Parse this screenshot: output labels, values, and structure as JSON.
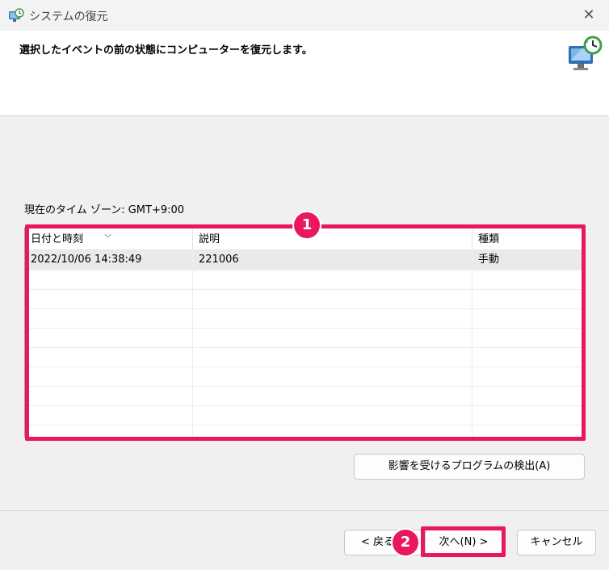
{
  "window": {
    "title": "システムの復元",
    "close_glyph": "✕"
  },
  "header": {
    "title": "選択したイベントの前の状態にコンピューターを復元します。"
  },
  "timezone_label": "現在のタイム ゾーン: GMT+9:00",
  "table": {
    "columns": [
      "日付と時刻",
      "説明",
      "種類"
    ],
    "rows": [
      {
        "date": "2022/10/06 14:38:49",
        "description": "221006",
        "type": "手動"
      }
    ]
  },
  "buttons": {
    "scan": "影響を受けるプログラムの検出(A)",
    "back": "< 戻る",
    "next": "次へ(N) >",
    "cancel": "キャンセル"
  },
  "annotations": {
    "badge1": "1",
    "badge2": "2"
  },
  "colors": {
    "highlight": "#e8175f",
    "background": "#f0f0f0",
    "selected_row": "#eaeaea"
  }
}
